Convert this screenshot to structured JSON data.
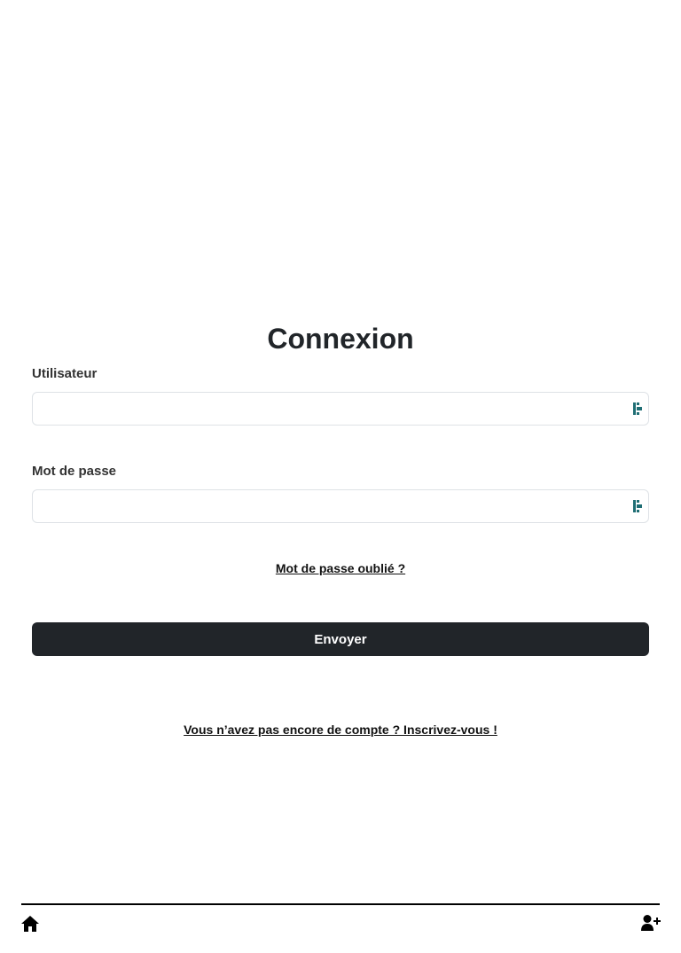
{
  "login": {
    "title": "Connexion",
    "username_label": "Utilisateur",
    "username_value": "",
    "password_label": "Mot de passe",
    "password_value": "",
    "forgot_password": "Mot de passe oublié ?",
    "submit_label": "Envoyer",
    "signup_link": "Vous n’avez pas encore de compte ? Inscrivez-vous !"
  },
  "footer": {
    "left_icon": "home-icon",
    "right_icon": "add-user-icon"
  },
  "colors": {
    "primary_dark": "#212529",
    "input_border": "#dee2e6",
    "password_manager_icon": "#1f6e74"
  }
}
